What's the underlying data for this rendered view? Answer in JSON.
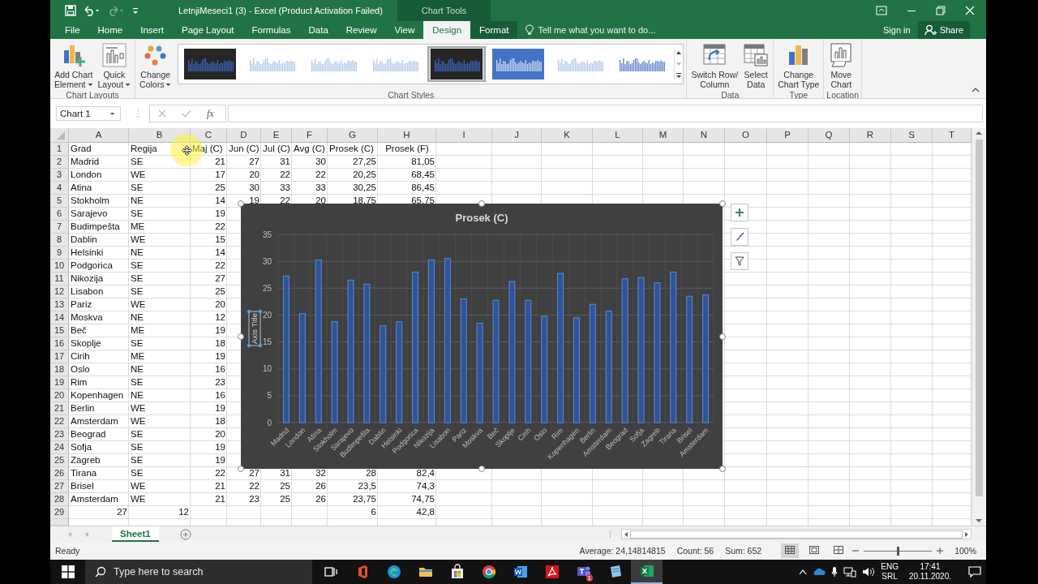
{
  "window": {
    "title": "LetnjiMeseci1 (3) - Excel (Product Activation Failed)",
    "contextual_header": "Chart Tools"
  },
  "ribbon_tabs": [
    {
      "label": "File",
      "selected": false,
      "contextual": false
    },
    {
      "label": "Home",
      "selected": false,
      "contextual": false
    },
    {
      "label": "Insert",
      "selected": false,
      "contextual": false
    },
    {
      "label": "Page Layout",
      "selected": false,
      "contextual": false
    },
    {
      "label": "Formulas",
      "selected": false,
      "contextual": false
    },
    {
      "label": "Data",
      "selected": false,
      "contextual": false
    },
    {
      "label": "Review",
      "selected": false,
      "contextual": false
    },
    {
      "label": "View",
      "selected": false,
      "contextual": false
    },
    {
      "label": "Design",
      "selected": true,
      "contextual": true
    },
    {
      "label": "Format",
      "selected": false,
      "contextual": true
    }
  ],
  "tell_me": {
    "placeholder": "Tell me what you want to do..."
  },
  "account": {
    "sign_in": "Sign in",
    "share": "Share"
  },
  "ribbon_groups": [
    {
      "label": "Chart Layouts",
      "buttons": [
        {
          "kind": "add-element",
          "lines": [
            "Add Chart",
            "Element"
          ],
          "dropdown": true
        },
        {
          "kind": "quick-layout",
          "lines": [
            "Quick",
            "Layout"
          ],
          "dropdown": true
        }
      ]
    },
    {
      "label": "Chart Styles",
      "buttons": [
        {
          "kind": "change-colors",
          "lines": [
            "Change",
            "Colors"
          ],
          "dropdown": true
        }
      ],
      "gallery": [
        {
          "kind": "dark",
          "selected": false
        },
        {
          "kind": "light",
          "selected": false
        },
        {
          "kind": "light",
          "selected": false
        },
        {
          "kind": "light",
          "selected": false
        },
        {
          "kind": "dark",
          "selected": true
        },
        {
          "kind": "blue",
          "selected": false
        },
        {
          "kind": "light",
          "selected": false
        },
        {
          "kind": "strong",
          "selected": false
        }
      ]
    },
    {
      "label": "Data",
      "buttons": [
        {
          "kind": "switch-row-column",
          "lines": [
            "Switch Row/",
            "Column"
          ],
          "dropdown": false
        },
        {
          "kind": "select-data",
          "lines": [
            "Select",
            "Data"
          ],
          "dropdown": false
        }
      ]
    },
    {
      "label": "Type",
      "buttons": [
        {
          "kind": "change-chart-type",
          "lines": [
            "Change",
            "Chart Type"
          ],
          "dropdown": false
        }
      ]
    },
    {
      "label": "Location",
      "buttons": [
        {
          "kind": "move-chart",
          "lines": [
            "Move",
            "Chart"
          ],
          "dropdown": false
        }
      ]
    }
  ],
  "formula_bar": {
    "name_box": "Chart 1",
    "function_label": "fx"
  },
  "sheet": {
    "columns": [
      "A",
      "B",
      "C",
      "D",
      "E",
      "F",
      "G",
      "H",
      "I",
      "J",
      "K",
      "L",
      "M",
      "N",
      "O",
      "P",
      "Q",
      "R",
      "S",
      "T"
    ],
    "rows": [
      {
        "number": "1",
        "cells": [
          {
            "value": "Grad",
            "kind": "text"
          },
          {
            "value": "Regija",
            "kind": "text"
          },
          {
            "value": "Maj (C)",
            "kind": "text"
          },
          {
            "value": "Jun (C)",
            "kind": "text"
          },
          {
            "value": "Jul (C)",
            "kind": "text"
          },
          {
            "value": "Avg (C)",
            "kind": "text"
          },
          {
            "value": "Prosek (C)",
            "kind": "text"
          },
          {
            "value": "Prosek (F)",
            "kind": "centered"
          }
        ]
      },
      {
        "number": "2",
        "cells": [
          {
            "value": "Madrid",
            "kind": "text"
          },
          {
            "value": "SE",
            "kind": "text"
          },
          {
            "value": "21",
            "kind": "number"
          },
          {
            "value": "27",
            "kind": "number"
          },
          {
            "value": "31",
            "kind": "number"
          },
          {
            "value": "30",
            "kind": "number"
          },
          {
            "value": "27,25",
            "kind": "number"
          },
          {
            "value": "81,05",
            "kind": "number"
          }
        ]
      },
      {
        "number": "3",
        "cells": [
          {
            "value": "London",
            "kind": "text"
          },
          {
            "value": "WE",
            "kind": "text"
          },
          {
            "value": "17",
            "kind": "number"
          },
          {
            "value": "20",
            "kind": "number"
          },
          {
            "value": "22",
            "kind": "number"
          },
          {
            "value": "22",
            "kind": "number"
          },
          {
            "value": "20,25",
            "kind": "number"
          },
          {
            "value": "68,45",
            "kind": "number"
          }
        ]
      },
      {
        "number": "4",
        "cells": [
          {
            "value": "Atina",
            "kind": "text"
          },
          {
            "value": "SE",
            "kind": "text"
          },
          {
            "value": "25",
            "kind": "number"
          },
          {
            "value": "30",
            "kind": "number"
          },
          {
            "value": "33",
            "kind": "number"
          },
          {
            "value": "33",
            "kind": "number"
          },
          {
            "value": "30,25",
            "kind": "number"
          },
          {
            "value": "86,45",
            "kind": "number"
          }
        ]
      },
      {
        "number": "5",
        "cells": [
          {
            "value": "Stokholm",
            "kind": "text"
          },
          {
            "value": "NE",
            "kind": "text"
          },
          {
            "value": "14",
            "kind": "number"
          },
          {
            "value": "19",
            "kind": "number"
          },
          {
            "value": "22",
            "kind": "number"
          },
          {
            "value": "20",
            "kind": "number"
          },
          {
            "value": "18,75",
            "kind": "number"
          },
          {
            "value": "65,75",
            "kind": "number"
          }
        ]
      },
      {
        "number": "6",
        "cells": [
          {
            "value": "Sarajevo",
            "kind": "text"
          },
          {
            "value": "SE",
            "kind": "text"
          },
          {
            "value": "19",
            "kind": "number"
          }
        ]
      },
      {
        "number": "7",
        "cells": [
          {
            "value": "Budimpešta",
            "kind": "text"
          },
          {
            "value": "ME",
            "kind": "text"
          },
          {
            "value": "22",
            "kind": "number"
          }
        ]
      },
      {
        "number": "8",
        "cells": [
          {
            "value": "Dablin",
            "kind": "text"
          },
          {
            "value": "WE",
            "kind": "text"
          },
          {
            "value": "15",
            "kind": "number"
          }
        ]
      },
      {
        "number": "9",
        "cells": [
          {
            "value": "Helsinki",
            "kind": "text"
          },
          {
            "value": "NE",
            "kind": "text"
          },
          {
            "value": "14",
            "kind": "number"
          }
        ]
      },
      {
        "number": "10",
        "cells": [
          {
            "value": "Podgorica",
            "kind": "text"
          },
          {
            "value": "SE",
            "kind": "text"
          },
          {
            "value": "22",
            "kind": "number"
          }
        ]
      },
      {
        "number": "11",
        "cells": [
          {
            "value": "Nikozija",
            "kind": "text"
          },
          {
            "value": "SE",
            "kind": "text"
          },
          {
            "value": "27",
            "kind": "number"
          }
        ]
      },
      {
        "number": "12",
        "cells": [
          {
            "value": "Lisabon",
            "kind": "text"
          },
          {
            "value": "SE",
            "kind": "text"
          },
          {
            "value": "25",
            "kind": "number"
          }
        ]
      },
      {
        "number": "13",
        "cells": [
          {
            "value": "Pariz",
            "kind": "text"
          },
          {
            "value": "WE",
            "kind": "text"
          },
          {
            "value": "20",
            "kind": "number"
          }
        ]
      },
      {
        "number": "14",
        "cells": [
          {
            "value": "Moskva",
            "kind": "text"
          },
          {
            "value": "NE",
            "kind": "text"
          },
          {
            "value": "12",
            "kind": "number"
          }
        ]
      },
      {
        "number": "15",
        "cells": [
          {
            "value": "Beč",
            "kind": "text"
          },
          {
            "value": "ME",
            "kind": "text"
          },
          {
            "value": "19",
            "kind": "number"
          }
        ]
      },
      {
        "number": "16",
        "cells": [
          {
            "value": "Skoplje",
            "kind": "text"
          },
          {
            "value": "SE",
            "kind": "text"
          },
          {
            "value": "18",
            "kind": "number"
          }
        ]
      },
      {
        "number": "17",
        "cells": [
          {
            "value": "Cirih",
            "kind": "text"
          },
          {
            "value": "ME",
            "kind": "text"
          },
          {
            "value": "19",
            "kind": "number"
          }
        ]
      },
      {
        "number": "18",
        "cells": [
          {
            "value": "Oslo",
            "kind": "text"
          },
          {
            "value": "NE",
            "kind": "text"
          },
          {
            "value": "16",
            "kind": "number"
          }
        ]
      },
      {
        "number": "19",
        "cells": [
          {
            "value": "Rim",
            "kind": "text"
          },
          {
            "value": "SE",
            "kind": "text"
          },
          {
            "value": "23",
            "kind": "number"
          }
        ]
      },
      {
        "number": "20",
        "cells": [
          {
            "value": "Kopenhagen",
            "kind": "text"
          },
          {
            "value": "NE",
            "kind": "text"
          },
          {
            "value": "16",
            "kind": "number"
          }
        ]
      },
      {
        "number": "21",
        "cells": [
          {
            "value": "Berlin",
            "kind": "text"
          },
          {
            "value": "WE",
            "kind": "text"
          },
          {
            "value": "19",
            "kind": "number"
          }
        ]
      },
      {
        "number": "22",
        "cells": [
          {
            "value": "Amsterdam",
            "kind": "text"
          },
          {
            "value": "WE",
            "kind": "text"
          },
          {
            "value": "18",
            "kind": "number"
          }
        ]
      },
      {
        "number": "23",
        "cells": [
          {
            "value": "Beograd",
            "kind": "text"
          },
          {
            "value": "SE",
            "kind": "text"
          },
          {
            "value": "20",
            "kind": "number"
          }
        ]
      },
      {
        "number": "24",
        "cells": [
          {
            "value": "Sofja",
            "kind": "text"
          },
          {
            "value": "SE",
            "kind": "text"
          },
          {
            "value": "19",
            "kind": "number"
          }
        ]
      },
      {
        "number": "25",
        "cells": [
          {
            "value": "Zagreb",
            "kind": "text"
          },
          {
            "value": "SE",
            "kind": "text"
          },
          {
            "value": "19",
            "kind": "number"
          }
        ]
      },
      {
        "number": "26",
        "cells": [
          {
            "value": "Tirana",
            "kind": "text"
          },
          {
            "value": "SE",
            "kind": "text"
          },
          {
            "value": "22",
            "kind": "number"
          },
          {
            "value": "27",
            "kind": "number"
          },
          {
            "value": "31",
            "kind": "number"
          },
          {
            "value": "32",
            "kind": "number"
          },
          {
            "value": "28",
            "kind": "number"
          },
          {
            "value": "82,4",
            "kind": "number"
          }
        ]
      },
      {
        "number": "27",
        "cells": [
          {
            "value": "Brisel",
            "kind": "text"
          },
          {
            "value": "WE",
            "kind": "text"
          },
          {
            "value": "21",
            "kind": "number"
          },
          {
            "value": "22",
            "kind": "number"
          },
          {
            "value": "25",
            "kind": "number"
          },
          {
            "value": "26",
            "kind": "number"
          },
          {
            "value": "23,5",
            "kind": "number"
          },
          {
            "value": "74,3",
            "kind": "number"
          }
        ]
      },
      {
        "number": "28",
        "cells": [
          {
            "value": "Amsterdam",
            "kind": "text"
          },
          {
            "value": "WE",
            "kind": "text"
          },
          {
            "value": "21",
            "kind": "number"
          },
          {
            "value": "23",
            "kind": "number"
          },
          {
            "value": "25",
            "kind": "number"
          },
          {
            "value": "26",
            "kind": "number"
          },
          {
            "value": "23,75",
            "kind": "number"
          },
          {
            "value": "74,75",
            "kind": "number"
          }
        ]
      },
      {
        "number": "29",
        "cells": [
          {
            "value": "27",
            "kind": "number"
          },
          {
            "value": "12",
            "kind": "number"
          },
          null,
          null,
          null,
          null,
          {
            "value": "6",
            "kind": "number"
          },
          {
            "value": "42,8",
            "kind": "number"
          }
        ]
      }
    ]
  },
  "chart": {
    "selected": true,
    "axis_title_selected": true,
    "chart_data": {
      "type": "bar",
      "title": "Prosek (C)",
      "ylabel": "Axis Title",
      "grid": true,
      "categories": [
        "Madrid",
        "London",
        "Atina",
        "Stokholm",
        "Sarajevo",
        "Budimpešta",
        "Dablin",
        "Helsinki",
        "Podgorica",
        "Nikozija",
        "Lisabon",
        "Pariz",
        "Moskva",
        "Beč",
        "Skoplje",
        "Cirih",
        "Oslo",
        "Rim",
        "Kopenhagen",
        "Berlin",
        "Amsterdam",
        "Beograd",
        "Sofja",
        "Zagreb",
        "Tirana",
        "Brisel",
        "Amsterdam"
      ],
      "series": [
        {
          "color": "#2f5597",
          "values": [
            27.25,
            20.25,
            30.25,
            18.75,
            26.5,
            25.75,
            18,
            18.75,
            28,
            30.25,
            30.5,
            23,
            18.5,
            22.75,
            26.25,
            22.75,
            19.75,
            27.75,
            19.5,
            22,
            20.75,
            26.75,
            27,
            26,
            28,
            23.5,
            23.75
          ]
        }
      ],
      "ylim": [
        0,
        35
      ],
      "yticks": [
        0,
        5,
        10,
        15,
        20,
        25,
        30,
        35
      ]
    }
  },
  "sheet_tabs": [
    {
      "label": "Sheet1",
      "selected": true
    }
  ],
  "status_bar": {
    "state": "Ready",
    "average": "Average: 24,14814815",
    "count": "Count: 56",
    "sum": "Sum: 652",
    "zoom": "100%",
    "zoom_slider": {
      "level": 0.5
    }
  },
  "taskbar": {
    "search_placeholder": "Type here to search",
    "apps": [
      {
        "kind": "task-view",
        "selected": false
      },
      {
        "kind": "office",
        "selected": false
      },
      {
        "kind": "edge",
        "selected": false
      },
      {
        "kind": "explorer",
        "selected": false
      },
      {
        "kind": "store",
        "selected": false
      },
      {
        "kind": "chrome",
        "selected": false
      },
      {
        "kind": "word",
        "selected": false
      },
      {
        "kind": "acrobat",
        "selected": false
      },
      {
        "kind": "teams",
        "selected": false,
        "badge": "1"
      },
      {
        "kind": "notes",
        "selected": false
      },
      {
        "kind": "excel",
        "selected": true
      }
    ],
    "language": "ENG",
    "layout": "SRL",
    "time": "17:41",
    "date": "20.11.2020."
  }
}
